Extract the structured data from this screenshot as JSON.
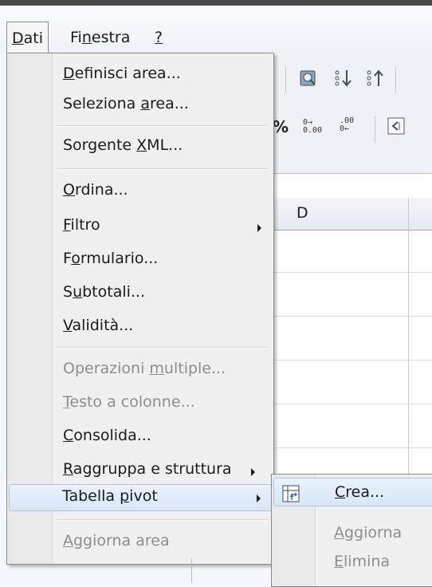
{
  "menubar": {
    "dati": {
      "pre": "",
      "ul": "D",
      "post": "ati"
    },
    "finestra": {
      "pre": "Fi",
      "ul": "n",
      "post": "estra"
    },
    "help": {
      "pre": "",
      "ul": "?",
      "post": ""
    }
  },
  "sheet": {
    "column_d": "D"
  },
  "toolbar": {
    "percent": "%",
    "dec_add": "0.00",
    "dec_rem": ".000"
  },
  "menu": {
    "items": [
      {
        "pre": "",
        "ul": "D",
        "post": "efinisci area..."
      },
      {
        "pre": "Seleziona ",
        "ul": "a",
        "post": "rea..."
      },
      {
        "pre": "Sorgente ",
        "ul": "X",
        "post": "ML..."
      },
      {
        "pre": "",
        "ul": "O",
        "post": "rdina..."
      },
      {
        "pre": "",
        "ul": "F",
        "post": "iltro"
      },
      {
        "pre": "F",
        "ul": "o",
        "post": "rmulario..."
      },
      {
        "pre": "S",
        "ul": "u",
        "post": "btotali..."
      },
      {
        "pre": "",
        "ul": "V",
        "post": "alidità..."
      },
      {
        "pre": "Operazioni ",
        "ul": "m",
        "post": "ultiple..."
      },
      {
        "pre": "",
        "ul": "T",
        "post": "esto a colonne..."
      },
      {
        "pre": "",
        "ul": "C",
        "post": "onsolida..."
      },
      {
        "pre": "",
        "ul": "R",
        "post": "aggruppa e struttura"
      },
      {
        "pre": "Tabella ",
        "ul": "p",
        "post": "ivot"
      },
      {
        "pre": "",
        "ul": "A",
        "post": "ggiorna area"
      }
    ]
  },
  "submenu": {
    "items": [
      {
        "pre": "",
        "ul": "C",
        "post": "rea..."
      },
      {
        "pre": "",
        "ul": "A",
        "post": "ggiorna"
      },
      {
        "pre": "",
        "ul": "E",
        "post": "limina"
      }
    ]
  },
  "icons": {
    "pivot_table": "pivot-table-icon",
    "submenu_arrow": "chevron-right-icon"
  }
}
